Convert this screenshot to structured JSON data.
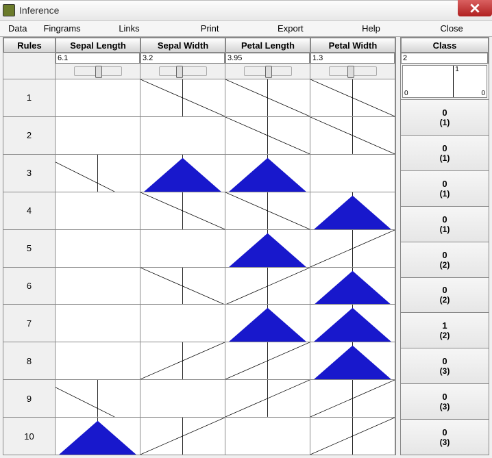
{
  "window": {
    "title": "Inference"
  },
  "menu": {
    "data": "Data",
    "fingrams": "Fingrams",
    "links": "Links",
    "print": "Print",
    "export": "Export",
    "help": "Help",
    "close": "Close"
  },
  "columns": {
    "rules": "Rules",
    "sl": "Sepal Length",
    "sw": "Sepal Width",
    "pl": "Petal Length",
    "pw": "Petal Width",
    "class": "Class"
  },
  "inputs": {
    "sl": "6.1",
    "sw": "3.2",
    "pl": "3.95",
    "pw": "1.3",
    "class": "2"
  },
  "graph": {
    "left": "0",
    "mid": "1",
    "right": "0"
  },
  "rows": [
    {
      "n": "1",
      "sl": "none-low",
      "sw": "diag-down",
      "pl": "diag-down",
      "pw": "diag-down",
      "v1": "0",
      "v2": "(1)"
    },
    {
      "n": "2",
      "sl": "none",
      "sw": "none",
      "pl": "diag-down",
      "pw": "diag-down",
      "v1": "0",
      "v2": "(1)"
    },
    {
      "n": "3",
      "sl": "diag-down-low",
      "sw": "tri-full",
      "pl": "tri-full",
      "pw": "none",
      "v1": "0",
      "v2": "(1)"
    },
    {
      "n": "4",
      "sl": "none",
      "sw": "diag-down",
      "pl": "diag-down",
      "pw": "tri-full",
      "v1": "0",
      "v2": "(1)"
    },
    {
      "n": "5",
      "sl": "none",
      "sw": "none",
      "pl": "tri-full",
      "pw": "diag-up",
      "v1": "0",
      "v2": "(2)"
    },
    {
      "n": "6",
      "sl": "none",
      "sw": "diag-down",
      "pl": "diag-up",
      "pw": "tri-full",
      "v1": "0",
      "v2": "(2)"
    },
    {
      "n": "7",
      "sl": "none",
      "sw": "none",
      "pl": "tri-full",
      "pw": "tri-full",
      "v1": "1",
      "v2": "(2)"
    },
    {
      "n": "8",
      "sl": "none",
      "sw": "diag-up",
      "pl": "diag-up",
      "pw": "tri-full",
      "v1": "0",
      "v2": "(3)"
    },
    {
      "n": "9",
      "sl": "diag-down-low",
      "sw": "none",
      "pl": "diag-up",
      "pw": "diag-up",
      "v1": "0",
      "v2": "(3)"
    },
    {
      "n": "10",
      "sl": "tri-full",
      "sw": "diag-up",
      "pl": "none",
      "pw": "diag-up",
      "v1": "0",
      "v2": "(3)"
    }
  ]
}
